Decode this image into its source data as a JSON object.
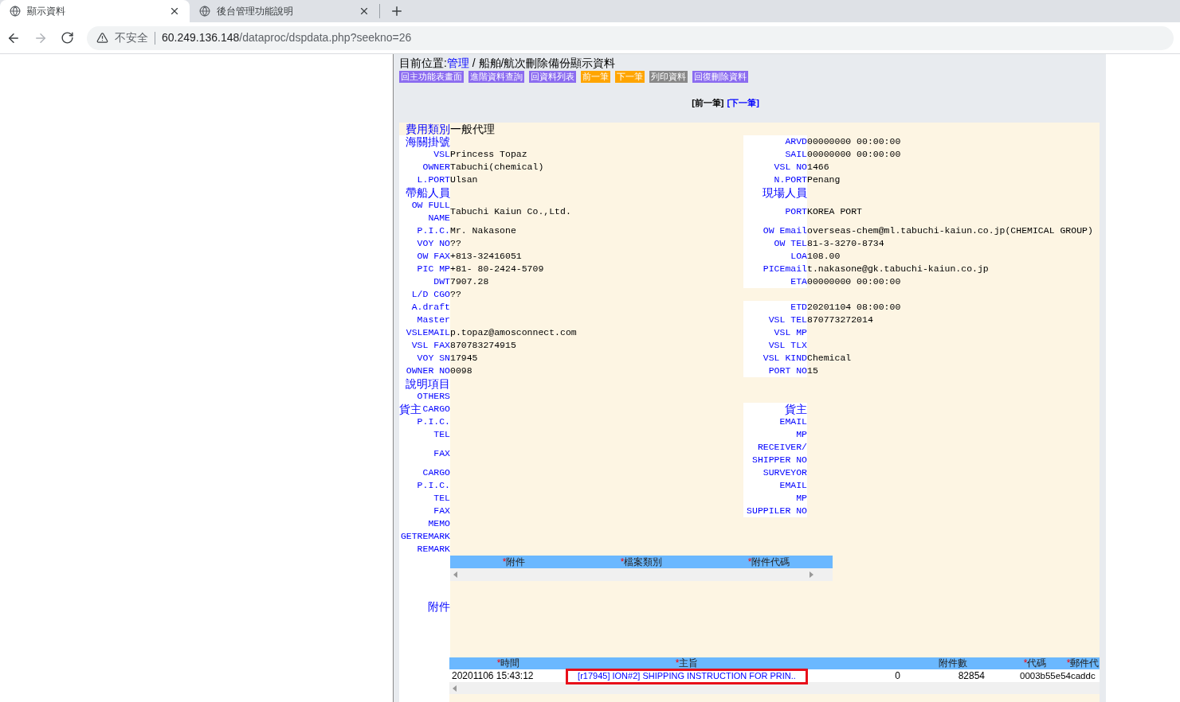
{
  "browser": {
    "tabs": [
      {
        "title": "顯示資料",
        "selected": true
      },
      {
        "title": "後台管理功能說明",
        "selected": false
      }
    ],
    "address": {
      "security": "不安全",
      "host": "60.249.136.148",
      "path": "/dataproc/dspdata.php?seekno=26"
    }
  },
  "location": {
    "prefix": "目前位置:",
    "link": "管理",
    "rest": " / 船舶/航次刪除備份顯示資料"
  },
  "nav_buttons": [
    {
      "label": "回主功能表畫面",
      "color": "#8b6cf0"
    },
    {
      "label": "進階資料查詢",
      "color": "#8b6cf0"
    },
    {
      "label": "回資料列表",
      "color": "#8b6cf0"
    },
    {
      "label": "前一筆",
      "color": "#ffa500"
    },
    {
      "label": "下一筆",
      "color": "#ffa500"
    },
    {
      "label": "列印資料",
      "color": "#888888"
    },
    {
      "label": "回復刪除資料",
      "color": "#8b6cf0"
    }
  ],
  "pager": [
    {
      "label": "[前一筆]",
      "kind": "text"
    },
    {
      "label": "[下一筆]",
      "kind": "link"
    }
  ],
  "rows": [
    {
      "left": {
        "kind": "title",
        "label": "費用類別",
        "value": "一般代理"
      }
    },
    {
      "left": {
        "kind": "heading",
        "label": "海關掛號"
      },
      "right": {
        "kind": "field",
        "label": "ARVD",
        "value": "00000000 00:00:00"
      }
    },
    {
      "left": {
        "kind": "field",
        "label": "VSL",
        "value": "Princess Topaz"
      },
      "right": {
        "kind": "field",
        "label": "SAIL",
        "value": "00000000 00:00:00"
      }
    },
    {
      "left": {
        "kind": "field",
        "label": "OWNER",
        "value": "Tabuchi(chemical)"
      },
      "right": {
        "kind": "field",
        "label": "VSL NO",
        "value": "1466"
      }
    },
    {
      "left": {
        "kind": "field",
        "label": "L.PORT",
        "value": "Ulsan"
      },
      "right": {
        "kind": "field",
        "label": "N.PORT",
        "value": "Penang"
      }
    },
    {
      "left": {
        "kind": "heading",
        "label": "帶船人員"
      },
      "right": {
        "kind": "heading",
        "label": "現場人員"
      }
    },
    {
      "left": {
        "kind": "field",
        "label": "OW FULL\nNAME",
        "value": "Tabuchi Kaiun Co.,Ltd."
      },
      "right": {
        "kind": "field",
        "label": "PORT",
        "value": "KOREA PORT"
      }
    },
    {
      "left": {
        "kind": "field",
        "label": "P.I.C.",
        "value": "Mr. Nakasone"
      },
      "right": {
        "kind": "field",
        "label": "OW Email",
        "value": "overseas-chem@ml.tabuchi-kaiun.co.jp(CHEMICAL GROUP)"
      }
    },
    {
      "left": {
        "kind": "field",
        "label": "VOY NO",
        "value": "??"
      },
      "right": {
        "kind": "field",
        "label": "OW TEL",
        "value": "81-3-3270-8734"
      }
    },
    {
      "left": {
        "kind": "field",
        "label": "OW FAX",
        "value": "+813-32416051"
      },
      "right": {
        "kind": "field",
        "label": "LOA",
        "value": "108.00"
      }
    },
    {
      "left": {
        "kind": "field",
        "label": "PIC MP",
        "value": "+81- 80-2424-5709"
      },
      "right": {
        "kind": "field",
        "label": "PICEmail",
        "value": "t.nakasone@gk.tabuchi-kaiun.co.jp"
      }
    },
    {
      "left": {
        "kind": "field",
        "label": "DWT",
        "value": "7907.28"
      },
      "right": {
        "kind": "field",
        "label": "ETA",
        "value": "00000000 00:00:00"
      }
    },
    {
      "left": {
        "kind": "field",
        "label": "L/D CGO",
        "value": "??"
      }
    },
    {
      "left": {
        "kind": "field",
        "label": "A.draft"
      },
      "right": {
        "kind": "field",
        "label": "ETD",
        "value": "20201104 08:00:00"
      }
    },
    {
      "left": {
        "kind": "field",
        "label": "Master"
      },
      "right": {
        "kind": "field",
        "label": "VSL TEL",
        "value": "870773272014"
      }
    },
    {
      "left": {
        "kind": "field",
        "label": "VSLEMAIL",
        "value": "p.topaz@amosconnect.com"
      },
      "right": {
        "kind": "field",
        "label": "VSL MP"
      }
    },
    {
      "left": {
        "kind": "field",
        "label": "VSL FAX",
        "value": "870783274915"
      },
      "right": {
        "kind": "field",
        "label": "VSL TLX"
      }
    },
    {
      "left": {
        "kind": "field",
        "label": "VOY SN",
        "value": "17945"
      },
      "right": {
        "kind": "field",
        "label": "VSL KIND",
        "value": "Chemical"
      }
    },
    {
      "left": {
        "kind": "field",
        "label": "OWNER NO",
        "value": "0098"
      },
      "right": {
        "kind": "field",
        "label": "PORT NO",
        "value": "15"
      }
    },
    {
      "left": {
        "kind": "heading",
        "label": "說明項目"
      }
    },
    {
      "left": {
        "kind": "field",
        "label": "OTHERS"
      }
    },
    {
      "left": {
        "kind": "mixed",
        "heading": "貨主",
        "label": "CARGO"
      },
      "right": {
        "kind": "heading",
        "label": "貨主"
      }
    },
    {
      "left": {
        "kind": "field",
        "label": "P.I.C."
      },
      "right": {
        "kind": "field",
        "label": "EMAIL"
      }
    },
    {
      "left": {
        "kind": "field",
        "label": "TEL"
      },
      "right": {
        "kind": "field",
        "label": "MP"
      }
    },
    {
      "left": {
        "kind": "field",
        "label": "FAX"
      },
      "right": {
        "kind": "field",
        "label": "RECEIVER/\nSHIPPER NO"
      }
    },
    {
      "left": {
        "kind": "field",
        "label": "CARGO"
      },
      "right": {
        "kind": "field",
        "label": "SURVEYOR"
      }
    },
    {
      "left": {
        "kind": "field",
        "label": "P.I.C."
      },
      "right": {
        "kind": "field",
        "label": "EMAIL"
      }
    },
    {
      "left": {
        "kind": "field",
        "label": "TEL"
      },
      "right": {
        "kind": "field",
        "label": "MP"
      }
    },
    {
      "left": {
        "kind": "field",
        "label": "FAX"
      },
      "right": {
        "kind": "field",
        "label": "SUPPILER NO"
      }
    },
    {
      "left": {
        "kind": "field",
        "label": "MEMO"
      }
    },
    {
      "left": {
        "kind": "field",
        "label": "GETREMARK"
      }
    },
    {
      "left": {
        "kind": "field",
        "label": "REMARK"
      }
    }
  ],
  "attachments": {
    "label": "附件",
    "columns": [
      {
        "mark": "*",
        "label": "附件"
      },
      {
        "mark": "*",
        "label": "檔案類別"
      },
      {
        "mark": "*",
        "label": "附件代碼"
      }
    ]
  },
  "mail_table": {
    "columns": [
      {
        "mark": "*",
        "label": "時間"
      },
      {
        "mark": "*",
        "label": "主旨"
      },
      {},
      {
        "label": "附件數"
      },
      {
        "mark": "*",
        "label": "代碼"
      },
      {
        "mark": "*",
        "label": "郵件代"
      }
    ],
    "rows": [
      {
        "cells": [
          "20201106 15:43:12",
          "[r17945] ION#2] SHIPPING INSTRUCTION FOR PRIN..",
          "0",
          "82854",
          "0003b55e54caddc"
        ],
        "highlighted": true
      }
    ]
  }
}
